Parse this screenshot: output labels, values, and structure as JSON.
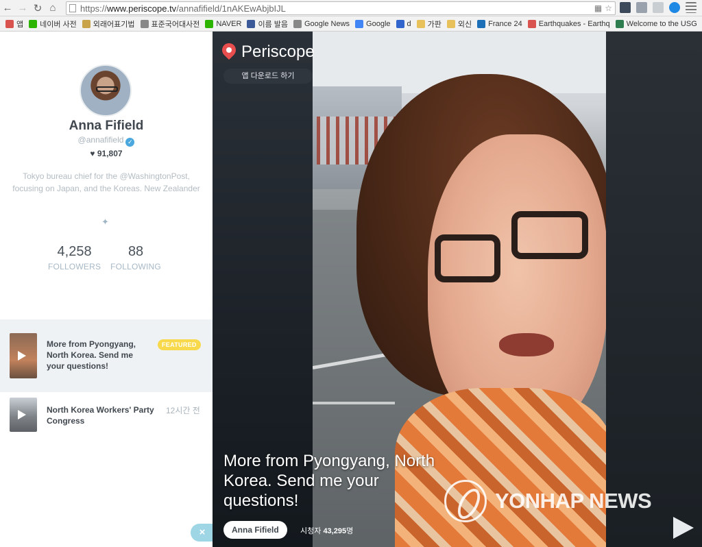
{
  "browser": {
    "url_protocol": "https://",
    "url_host": "www.periscope.tv",
    "url_path": "/annafifield/1nAKEwAbjbIJL",
    "bookmarks": [
      {
        "label": "앱",
        "color": "#d9534f"
      },
      {
        "label": "네이버 사전",
        "color": "#2db400"
      },
      {
        "label": "외래어표기법",
        "color": "#c8a34a"
      },
      {
        "label": "표준국어대사전",
        "color": "#888888"
      },
      {
        "label": "NAVER",
        "color": "#2db400"
      },
      {
        "label": "이름 발음",
        "color": "#3b5998"
      },
      {
        "label": "Google News",
        "color": "#888888"
      },
      {
        "label": "Google",
        "color": "#4285f4"
      },
      {
        "label": "d",
        "color": "#3366cc"
      },
      {
        "label": "가판",
        "color": "#e8c15a"
      },
      {
        "label": "외신",
        "color": "#e8c15a"
      },
      {
        "label": "France 24",
        "color": "#1d6fb8"
      },
      {
        "label": "Earthquakes - Earthq",
        "color": "#d9534f"
      },
      {
        "label": "Welcome to the USG",
        "color": "#2e7d4f"
      }
    ]
  },
  "profile": {
    "name": "Anna Fifield",
    "handle": "@annafifield",
    "hearts": "91,807",
    "bio": "Tokyo bureau chief for the @WashingtonPost, focusing on Japan, and the Koreas. New Zealander",
    "followers_count": "4,258",
    "followers_label": "FOLLOWERS",
    "following_count": "88",
    "following_label": "FOLLOWING"
  },
  "broadcasts": [
    {
      "title": "More from Pyongyang, North Korea. Send me your questions!",
      "badge": "FEATURED"
    },
    {
      "title": "North Korea Workers' Party Congress",
      "time": "12시간 전"
    }
  ],
  "close_label": "×",
  "stage": {
    "brand": "Periscope",
    "download_label": "앱 다운로드 하기",
    "caption": "More from Pyongyang, North Korea. Send me your questions!",
    "broadcaster": "Anna Fifield",
    "viewers_label": "시청자",
    "viewers_count": "43,295",
    "viewers_unit": "명",
    "watermark": "YONHAP NEWS"
  },
  "colors": {
    "brand_red": "#e94e4e",
    "featured_yellow": "#f8d94c",
    "verified_blue": "#4aa8de"
  }
}
